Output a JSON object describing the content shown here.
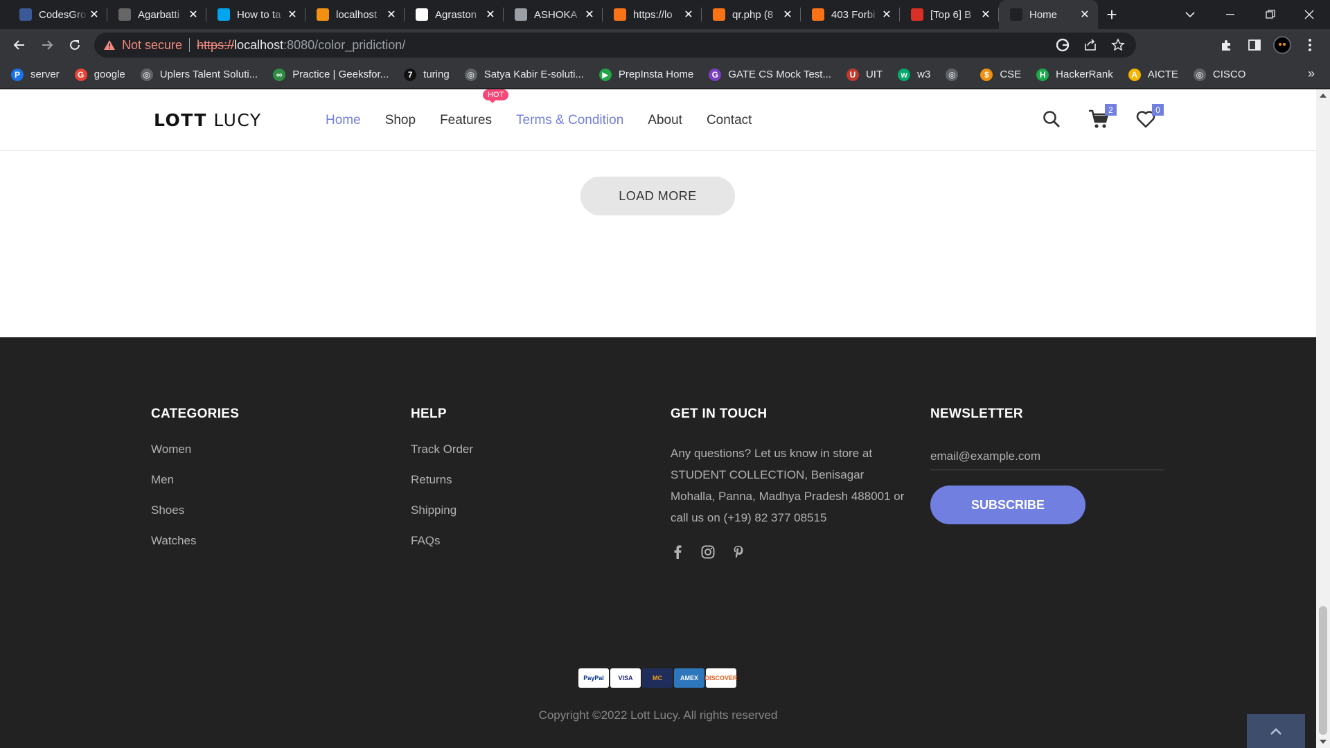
{
  "browser": {
    "tabs": [
      {
        "title": "CodesGro",
        "favicon_color": "#3b5998"
      },
      {
        "title": "Agarbatti",
        "favicon_color": "#666666"
      },
      {
        "title": "How to ta",
        "favicon_color": "#00a4ef"
      },
      {
        "title": "localhost",
        "favicon_color": "#f29111"
      },
      {
        "title": "Agraston",
        "favicon_color": "#ffffff"
      },
      {
        "title": "ASHOKA",
        "favicon_color": "#9aa0a6"
      },
      {
        "title": "https://lo",
        "favicon_color": "#f97316"
      },
      {
        "title": "qr.php (8",
        "favicon_color": "#f97316"
      },
      {
        "title": "403 Forbi",
        "favicon_color": "#f97316"
      },
      {
        "title": "[Top 6] B",
        "favicon_color": "#d93025"
      },
      {
        "title": "Home",
        "favicon_color": "#202124"
      }
    ],
    "close_glyph": "✕",
    "new_tab_glyph": "+",
    "address": {
      "warning": "Not secure",
      "scheme": "https://",
      "host": "localhost",
      "path": ":8080/color_pridiction/"
    },
    "bookmarks": [
      {
        "label": "server",
        "icon": "P",
        "color": "#1a73e8"
      },
      {
        "label": "google",
        "icon": "G",
        "color": "#ea4335"
      },
      {
        "label": "Uplers Talent Soluti...",
        "icon": "◎",
        "color": "#5f6368"
      },
      {
        "label": "Practice | Geeksfor...",
        "icon": "∞",
        "color": "#2f8d46"
      },
      {
        "label": "turing",
        "icon": "7",
        "color": "#111111"
      },
      {
        "label": "Satya Kabir E-soluti...",
        "icon": "◎",
        "color": "#5f6368"
      },
      {
        "label": "PrepInsta Home",
        "icon": "▶",
        "color": "#22a447"
      },
      {
        "label": "GATE CS Mock Test...",
        "icon": "G",
        "color": "#7b3fbf"
      },
      {
        "label": "UIT",
        "icon": "U",
        "color": "#c0392b"
      },
      {
        "label": "w3",
        "icon": "w",
        "color": "#04aa6d"
      },
      {
        "label": "",
        "icon": "◎",
        "color": "#5f6368"
      },
      {
        "label": "CSE",
        "icon": "$",
        "color": "#f29111"
      },
      {
        "label": "HackerRank",
        "icon": "H",
        "color": "#1ba94c"
      },
      {
        "label": "AICTE",
        "icon": "A",
        "color": "#f4b400"
      },
      {
        "label": "CISCO",
        "icon": "◎",
        "color": "#5f6368"
      }
    ],
    "more_glyph": "»"
  },
  "site": {
    "logo_bold": "LOTT",
    "logo_light": " LUCY",
    "nav": [
      {
        "label": "Home"
      },
      {
        "label": "Shop"
      },
      {
        "label": "Features",
        "badge": "HOT"
      },
      {
        "label": "Terms & Condition"
      },
      {
        "label": "About"
      },
      {
        "label": "Contact"
      }
    ],
    "cart_count": "2",
    "wishlist_count": "0",
    "load_more": "LOAD MORE",
    "accent": "#717fe0"
  },
  "footer": {
    "categories": {
      "heading": "CATEGORIES",
      "links": [
        "Women",
        "Men",
        "Shoes",
        "Watches"
      ]
    },
    "help": {
      "heading": "HELP",
      "links": [
        "Track Order",
        "Returns",
        "Shipping",
        "FAQs"
      ]
    },
    "contact": {
      "heading": "GET IN TOUCH",
      "text": "Any questions? Let us know in store at STUDENT COLLECTION, Benisagar Mohalla, Panna, Madhya Pradesh 488001 or call us on (+19) 82 377 08515"
    },
    "newsletter": {
      "heading": "NEWSLETTER",
      "placeholder": "email@example.com",
      "button": "SUBSCRIBE"
    },
    "payments": [
      {
        "label": "PayPal",
        "bg": "#ffffff",
        "fg": "#003087"
      },
      {
        "label": "VISA",
        "bg": "#ffffff",
        "fg": "#1a1f71"
      },
      {
        "label": "MC",
        "bg": "#1f2d5a",
        "fg": "#f79e1b"
      },
      {
        "label": "AMEX",
        "bg": "#2e77bc",
        "fg": "#ffffff"
      },
      {
        "label": "DISCOVER",
        "bg": "#ffffff",
        "fg": "#e55c20"
      }
    ],
    "copyright": "Copyright ©2022 Lott Lucy. All rights reserved"
  }
}
